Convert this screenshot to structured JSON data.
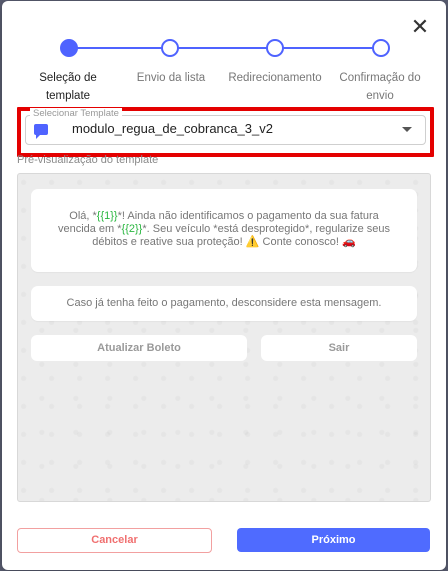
{
  "modal": {
    "close_label": "✕",
    "steps": [
      {
        "label_line1": "Seleção de",
        "label_line2": "template",
        "active": true
      },
      {
        "label_line1": "Envio da lista",
        "label_line2": "",
        "active": false
      },
      {
        "label_line1": "Redirecionamento",
        "label_line2": "",
        "active": false
      },
      {
        "label_line1": "Confirmação do",
        "label_line2": "envio",
        "active": false
      }
    ],
    "select": {
      "legend": "Selecionar Template",
      "value": "modulo_regua_de_cobranca_3_v2",
      "icon": "chat-bubble-icon"
    },
    "preview_label": "Pré-visualização do template",
    "preview": {
      "message_part1": "Olá, *",
      "var1": "{{1}}",
      "message_part2": "*! Ainda não identificamos o pagamento da sua fatura vencida em *",
      "var2": "{{2}}",
      "message_part3": "*. Seu veículo *está desprotegido*, regularize seus débitos e reative sua proteção! ⚠️ Conte conosco! 🚗",
      "secondary": "Caso já tenha feito o pagamento, desconsidere esta mensagem.",
      "button1": "Atualizar Boleto",
      "button2": "Sair"
    },
    "footer": {
      "cancel": "Cancelar",
      "next": "Próximo"
    }
  },
  "colors": {
    "accent": "#4f63ff",
    "highlight": "#e40000",
    "cancel": "#f07070",
    "variable": "#2bb741"
  }
}
